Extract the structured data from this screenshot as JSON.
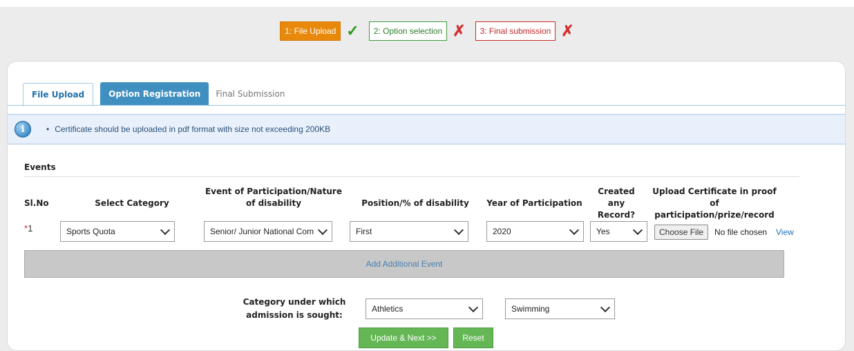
{
  "steps": [
    {
      "label": "1: File Upload",
      "status_icon": "check-icon"
    },
    {
      "label": "2: Option selection",
      "status_icon": "cross-icon"
    },
    {
      "label": "3: Final submission",
      "status_icon": "cross-icon"
    }
  ],
  "marks": {
    "ok": "✓",
    "bad": "✗"
  },
  "tabs": [
    {
      "label": "File Upload",
      "state": "active"
    },
    {
      "label": "Option Registration",
      "state": "highlighted"
    },
    {
      "label": "Final Submission",
      "state": "inactive"
    }
  ],
  "info": {
    "icon": "info-icon",
    "text": "Certificate should be uploaded in pdf format with size not exceeding 200KB"
  },
  "events": {
    "title": "Events",
    "headers": {
      "slno": "Sl.No",
      "category": "Select Category",
      "event": "Event of Participation/Nature of disability",
      "position": "Position/% of disability",
      "year": "Year of Participation",
      "record": "Created any Record?",
      "upload": "Upload Certificate in proof of participation/prize/record"
    },
    "rows": [
      {
        "required_marker": "*",
        "slno": "1",
        "category": "Sports Quota",
        "event": "Senior/ Junior National Com",
        "position": "First",
        "year": "2020",
        "record": "Yes",
        "file_button": "Choose File",
        "file_status": "No file chosen",
        "view_link": "View"
      }
    ],
    "add_label": "Add Additional Event"
  },
  "admission": {
    "label": "Category under which admission is sought:",
    "choice1": "Athletics",
    "choice2": "Swimming"
  },
  "buttons": {
    "update": "Update & Next >>",
    "reset": "Reset"
  },
  "colors": {
    "step1": "#e8890c",
    "step2": "#3f9a3f",
    "step3": "#c62828",
    "tab_blue": "#3f8fc0",
    "button_green": "#65b756"
  }
}
